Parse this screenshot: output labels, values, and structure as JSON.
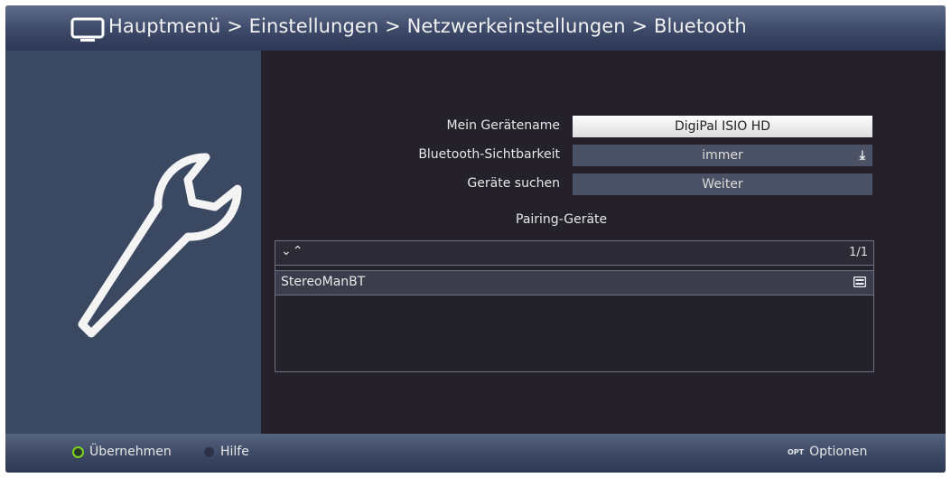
{
  "title_bar": {
    "icon": "tv-icon",
    "breadcrumb": "Hauptmenü > Einstellungen > Netzwerkeinstellungen > Bluetooth"
  },
  "left_pane": {
    "icon": "wrench-icon"
  },
  "settings": [
    {
      "label": "Mein Gerätename",
      "value": "DigiPal ISIO HD"
    },
    {
      "label": "Bluetooth-Sichtbarkeit",
      "value": "immer",
      "icon": "dropdown-arrow-icon"
    },
    {
      "label": "Geräte suchen",
      "value": "Weiter"
    }
  ],
  "pairing": {
    "heading": "Pairing-Geräte",
    "scroll_arrows": "⌄⌃",
    "page_indicator": "1/1",
    "devices": [
      {
        "name": "StereoManBT",
        "icon": "device-type-icon"
      }
    ]
  },
  "bottom_bar": {
    "accept_label": "Übernehmen",
    "help_label": "Hilfe",
    "options_badge": "OPT",
    "options_label": "Optionen"
  },
  "colors": {
    "green_key": "#7ed321",
    "highlight_field": "#f2f2f2",
    "field": "#4c5265",
    "panel": "#3b4862"
  }
}
